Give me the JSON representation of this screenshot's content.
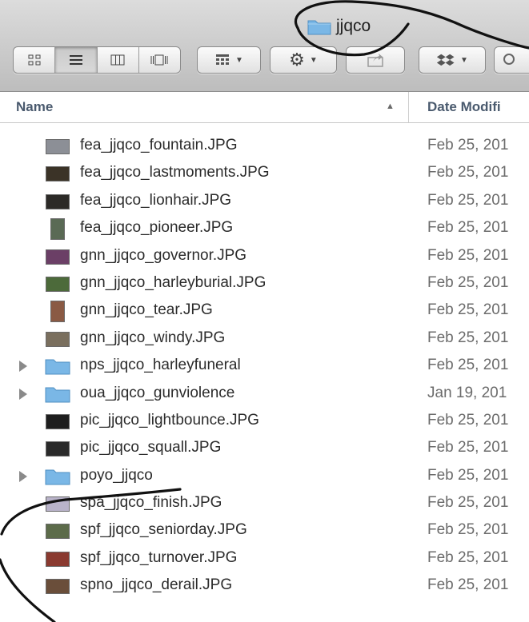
{
  "window": {
    "title": "jjqco"
  },
  "columns": {
    "name": "Name",
    "date_modified": "Date Modifi"
  },
  "files": [
    {
      "name": "fea_jjqco_fountain.JPG",
      "date": "Feb 25, 201",
      "kind": "image",
      "thumb": "#8c8f96"
    },
    {
      "name": "fea_jjqco_lastmoments.JPG",
      "date": "Feb 25, 201",
      "kind": "image",
      "thumb": "#3b3327"
    },
    {
      "name": "fea_jjqco_lionhair.JPG",
      "date": "Feb 25, 201",
      "kind": "image",
      "thumb": "#2c2a27"
    },
    {
      "name": "fea_jjqco_pioneer.JPG",
      "date": "Feb 25, 201",
      "kind": "image-tall",
      "thumb": "#5a6a55"
    },
    {
      "name": "gnn_jjqco_governor.JPG",
      "date": "Feb 25, 201",
      "kind": "image",
      "thumb": "#6b3f66"
    },
    {
      "name": "gnn_jjqco_harleyburial.JPG",
      "date": "Feb 25, 201",
      "kind": "image",
      "thumb": "#4c6a3a"
    },
    {
      "name": "gnn_jjqco_tear.JPG",
      "date": "Feb 25, 201",
      "kind": "image-tall",
      "thumb": "#8a5a44"
    },
    {
      "name": "gnn_jjqco_windy.JPG",
      "date": "Feb 25, 201",
      "kind": "image",
      "thumb": "#7a6f5e"
    },
    {
      "name": "nps_jjqco_harleyfuneral",
      "date": "Feb 25, 201",
      "kind": "folder"
    },
    {
      "name": "oua_jjqco_gunviolence",
      "date": "Jan 19, 201",
      "kind": "folder"
    },
    {
      "name": "pic_jjqco_lightbounce.JPG",
      "date": "Feb 25, 201",
      "kind": "image",
      "thumb": "#1e1e1e"
    },
    {
      "name": "pic_jjqco_squall.JPG",
      "date": "Feb 25, 201",
      "kind": "image",
      "thumb": "#2a2a2a"
    },
    {
      "name": "poyo_jjqco",
      "date": "Feb 25, 201",
      "kind": "folder"
    },
    {
      "name": "spa_jjqco_finish.JPG",
      "date": "Feb 25, 201",
      "kind": "image",
      "thumb": "#b9b3c9"
    },
    {
      "name": "spf_jjqco_seniorday.JPG",
      "date": "Feb 25, 201",
      "kind": "image",
      "thumb": "#5c6b4a"
    },
    {
      "name": "spf_jjqco_turnover.JPG",
      "date": "Feb 25, 201",
      "kind": "image",
      "thumb": "#8a3a30"
    },
    {
      "name": "spno_jjqco_derail.JPG",
      "date": "Feb 25, 201",
      "kind": "image",
      "thumb": "#6a4e3a"
    }
  ],
  "icons": {
    "title_folder": "folder-icon",
    "view_icon": "icon-view-icon",
    "view_list": "list-view-icon",
    "view_column": "column-view-icon",
    "view_coverflow": "coverflow-view-icon",
    "arrange": "arrange-icon",
    "action": "gear-icon",
    "share": "share-icon",
    "dropbox": "dropbox-icon"
  },
  "colors": {
    "folder": "#7ab7e6",
    "annotation": "#111111"
  }
}
